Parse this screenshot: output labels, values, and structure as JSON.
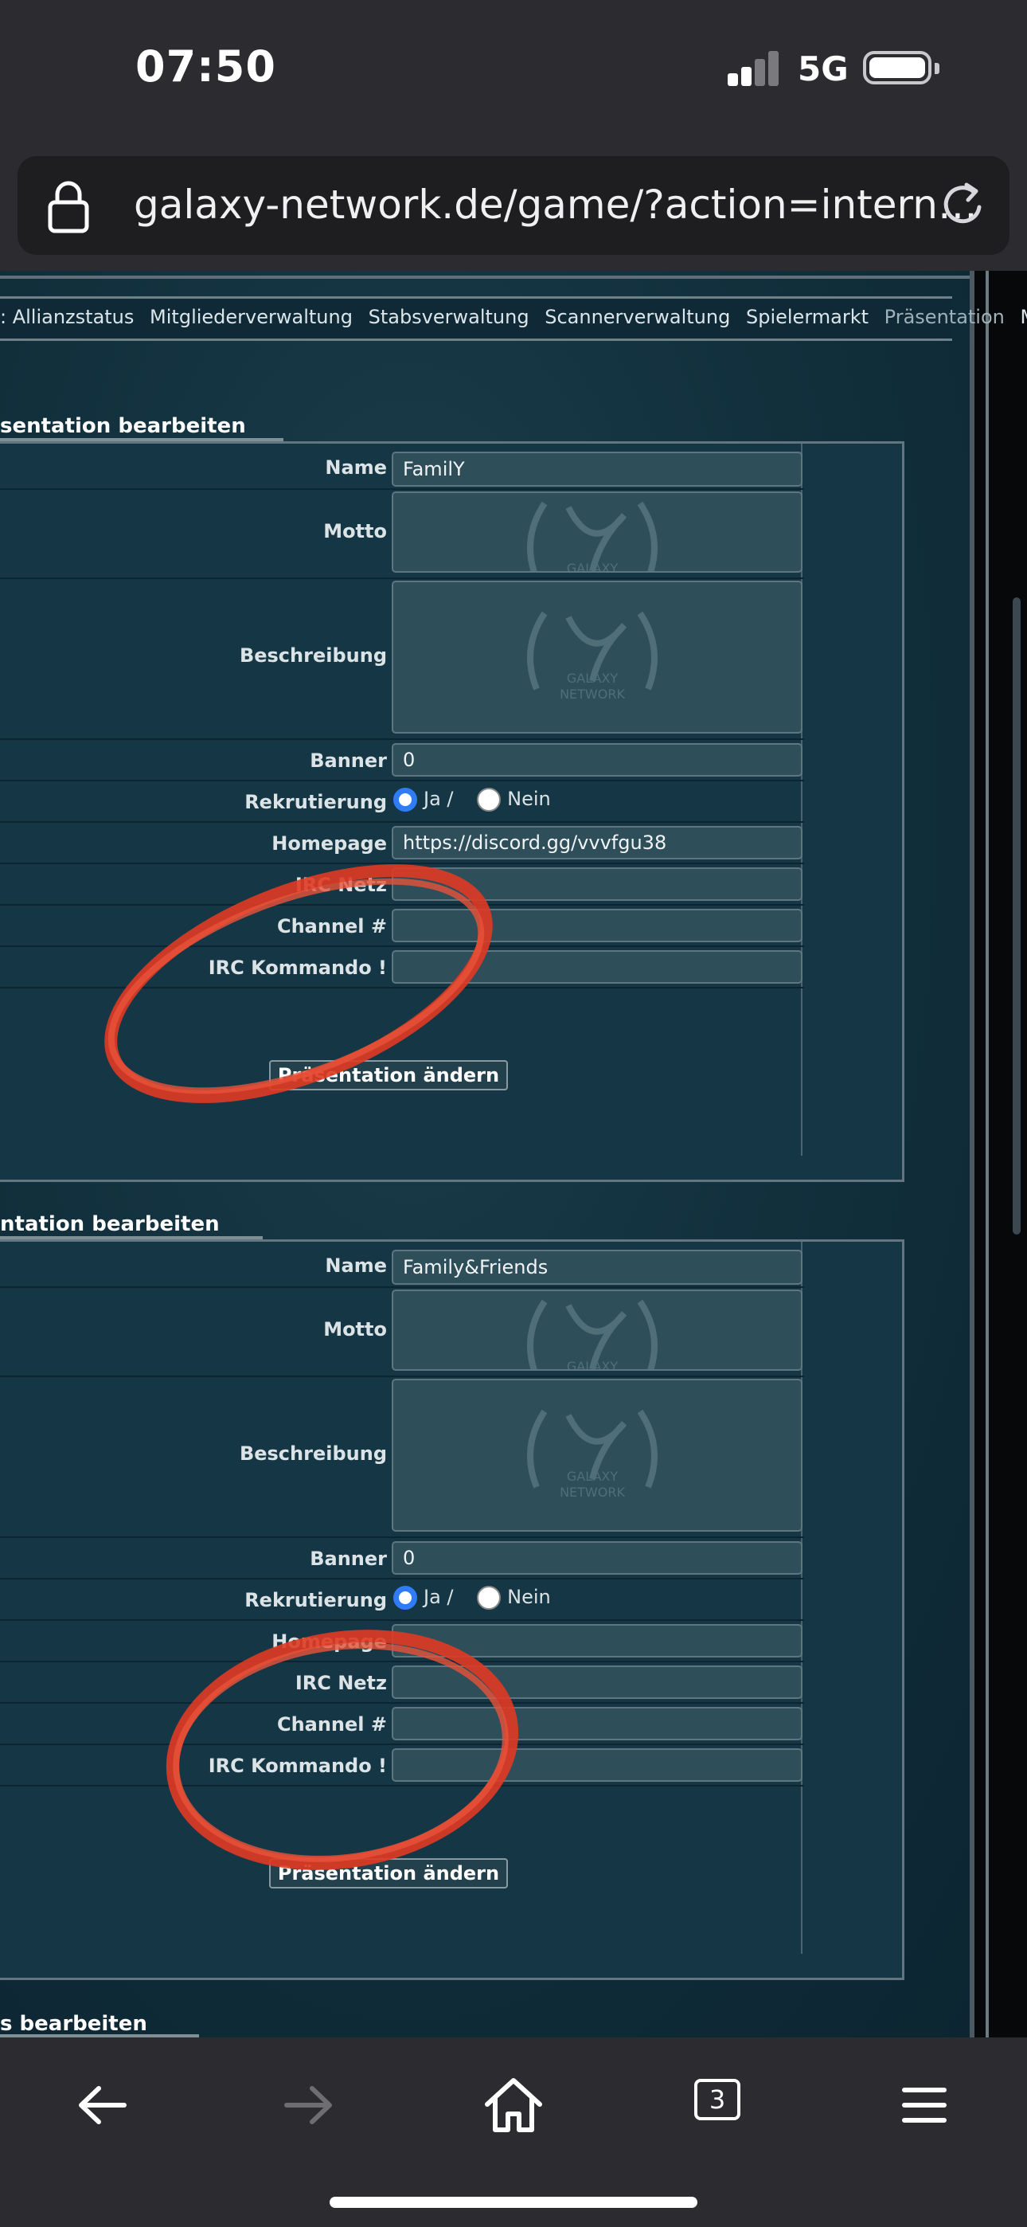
{
  "status_bar": {
    "time": "07:50",
    "network": "5G",
    "icons": [
      "signal-icon",
      "battery-icon"
    ]
  },
  "browser": {
    "url": "galaxy-network.de/game/?action=intern…",
    "icons": [
      "lock-icon",
      "reload-icon"
    ]
  },
  "nav": {
    "items": [
      ": Allianzstatus",
      "Mitgliederverwaltung",
      "Stabsverwaltung",
      "Scannerverwaltung",
      "Spielermarkt",
      "Präsentation",
      "Meta"
    ],
    "active_index": 5
  },
  "panels": [
    {
      "title": "sentation bearbeiten",
      "fields": {
        "name_label": "Name",
        "name_value": "FamilY",
        "motto_label": "Motto",
        "motto_value": "",
        "beschreibung_label": "Beschreibung",
        "beschreibung_value": "",
        "banner_label": "Banner",
        "banner_value": "0",
        "rekrutierung_label": "Rekrutierung",
        "ja_label": "Ja /",
        "nein_label": "Nein",
        "homepage_label": "Homepage",
        "homepage_value": "https://discord.gg/vvvfgu38",
        "irc_netz_label": "IRC Netz",
        "irc_netz_value": "",
        "channel_label": "Channel #",
        "channel_value": "",
        "irc_kommando_label": "IRC Kommando !",
        "irc_kommando_value": ""
      },
      "submit_label": "Präsentation ändern"
    },
    {
      "title": "ntation bearbeiten",
      "fields": {
        "name_label": "Name",
        "name_value": "Family&Friends",
        "motto_label": "Motto",
        "motto_value": "",
        "beschreibung_label": "Beschreibung",
        "beschreibung_value": "",
        "banner_label": "Banner",
        "banner_value": "0",
        "rekrutierung_label": "Rekrutierung",
        "ja_label": "Ja /",
        "nein_label": "Nein",
        "homepage_label": "Homepage",
        "homepage_value": "",
        "irc_netz_label": "IRC Netz",
        "irc_netz_value": "",
        "channel_label": "Channel #",
        "channel_value": "",
        "irc_kommando_label": "IRC Kommando !",
        "irc_kommando_value": ""
      },
      "submit_label": "Präsentation ändern"
    }
  ],
  "third_panel_title": "s bearbeiten",
  "toolbar": {
    "tabs_count": "3",
    "icons": [
      "back-arrow-icon",
      "forward-arrow-icon",
      "home-icon",
      "tabs-icon",
      "menu-icon"
    ]
  },
  "colors": {
    "accent_radio": "#2f7cf6",
    "annotation_red": "#e03a22",
    "page_bg": "#12303d"
  }
}
